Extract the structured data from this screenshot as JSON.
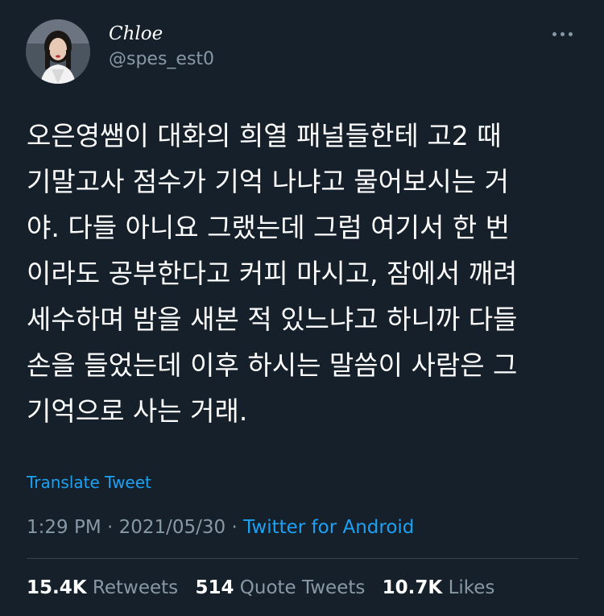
{
  "author": {
    "display_name": "Chloe",
    "handle": "@spes_est0",
    "avatar_icon": "profile-photo"
  },
  "more_icon": "more-dots-icon",
  "tweet": {
    "lines": [
      "오은영쌤이 대화의 희열 패널들한테 고2 때",
      "기말고사 점수가 기억 나냐고 물어보시는 거",
      "야. 다들 아니요 그랬는데 그럼 여기서 한 번",
      "이라도 공부한다고 커피 마시고, 잠에서 깨려",
      "세수하며 밤을 새본 적 있느냐고 하니까 다들",
      "손을 들었는데 이후 하시는 말씀이 사람은 그",
      "기억으로 사는 거래."
    ]
  },
  "translate_label": "Translate Tweet",
  "meta": {
    "time": "1:29 PM",
    "separator1": " · ",
    "date": "2021/05/30",
    "separator2": " · ",
    "source": "Twitter for Android"
  },
  "stats": {
    "retweets_count": "15.4K",
    "retweets_label": "Retweets",
    "quote_count": "514",
    "quote_label": "Quote Tweets",
    "likes_count": "10.7K",
    "likes_label": "Likes"
  },
  "colors": {
    "background": "#15202b",
    "text": "#ffffff",
    "secondary": "#8899a6",
    "link": "#1da1f2",
    "divider": "#38444d"
  }
}
